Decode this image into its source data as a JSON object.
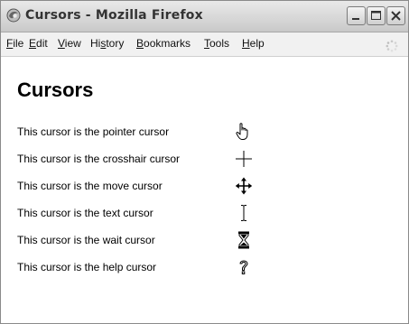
{
  "window": {
    "title": "Cursors - Mozilla Firefox",
    "controls": [
      "minimize",
      "maximize",
      "close"
    ]
  },
  "menubar": {
    "items": [
      {
        "label": "File",
        "mnemonic": "F"
      },
      {
        "label": "Edit",
        "mnemonic": "E"
      },
      {
        "label": "View",
        "mnemonic": "V"
      },
      {
        "label": "History",
        "mnemonic": "s"
      },
      {
        "label": "Bookmarks",
        "mnemonic": "B"
      },
      {
        "label": "Tools",
        "mnemonic": "T"
      },
      {
        "label": "Help",
        "mnemonic": "H"
      }
    ]
  },
  "page": {
    "title": "Cursors",
    "rows": [
      {
        "label": "This cursor is the pointer cursor",
        "icon": "hand-pointer-icon"
      },
      {
        "label": "This cursor is the crosshair cursor",
        "icon": "crosshair-icon"
      },
      {
        "label": "This cursor is the move cursor",
        "icon": "move-arrows-icon"
      },
      {
        "label": "This cursor is the text cursor",
        "icon": "text-ibeam-icon"
      },
      {
        "label": "This cursor is the wait cursor",
        "icon": "hourglass-icon"
      },
      {
        "label": "This cursor is the help cursor",
        "icon": "help-question-icon"
      }
    ]
  }
}
